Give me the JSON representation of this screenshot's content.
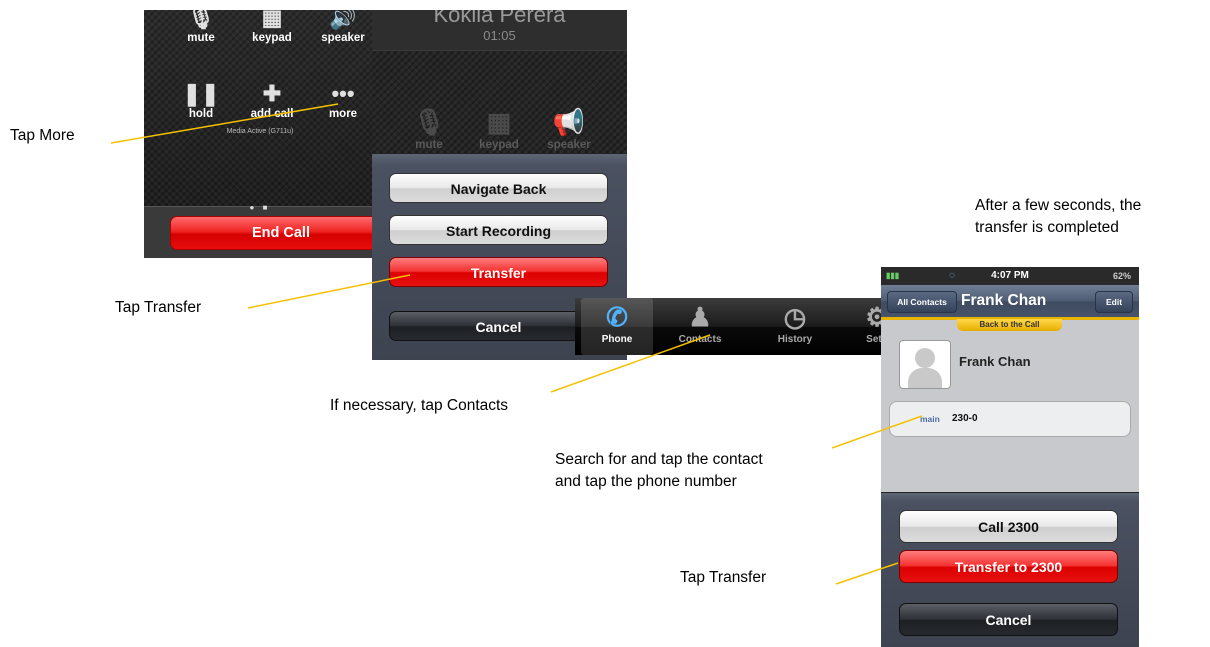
{
  "call_screen": {
    "buttons": [
      {
        "label": "mute",
        "icon": "mic-off-icon"
      },
      {
        "label": "keypad",
        "icon": "keypad-icon"
      },
      {
        "label": "speaker",
        "icon": "speaker-icon"
      },
      {
        "label": "hold",
        "icon": "pause-icon"
      },
      {
        "label": "add call",
        "icon": "plus-icon"
      },
      {
        "label": "more",
        "icon": "ellipsis-icon"
      }
    ],
    "media_status": "Media Active (G711u)",
    "end_call_label": "End Call"
  },
  "menu_screen": {
    "caller_name": "Kokila Perera",
    "call_timer": "01:05",
    "dim_buttons": [
      "mute",
      "keypad",
      "speaker"
    ],
    "action_sheet": [
      "Navigate Back",
      "Start Recording",
      "Transfer",
      "Cancel"
    ]
  },
  "tab_bar": {
    "tabs": [
      {
        "label": "Phone",
        "icon": "phone-icon",
        "active": true
      },
      {
        "label": "Contacts",
        "icon": "contacts-icon",
        "active": false
      },
      {
        "label": "History",
        "icon": "clock-icon",
        "active": false
      },
      {
        "label": "Setti",
        "icon": "gear-icon",
        "active": false
      }
    ]
  },
  "contact_screen": {
    "status_time": "4:07 PM",
    "battery": "62%",
    "back_button": "All Contacts",
    "title": "Frank Chan",
    "edit_button": "Edit",
    "back_to_call": "Back to the Call",
    "contact_name": "Frank Chan",
    "phone_type": "main",
    "phone_number": "230-0",
    "action_sheet": [
      "Call 2300",
      "Transfer to 2300",
      "Cancel"
    ]
  },
  "annotations": {
    "tap_more": "Tap More",
    "tap_transfer_1": "Tap Transfer",
    "tap_contacts": "If necessary, tap Contacts",
    "search_line1": "Search for and tap the contact",
    "search_line2": "and tap the phone number",
    "tap_transfer_2": "Tap Transfer",
    "completed_line1": "After a few seconds, the",
    "completed_line2": "transfer is completed"
  },
  "colors": {
    "leader": "#f5c000",
    "end_call": "#e60000",
    "contacts_bar": "#e9b400"
  }
}
